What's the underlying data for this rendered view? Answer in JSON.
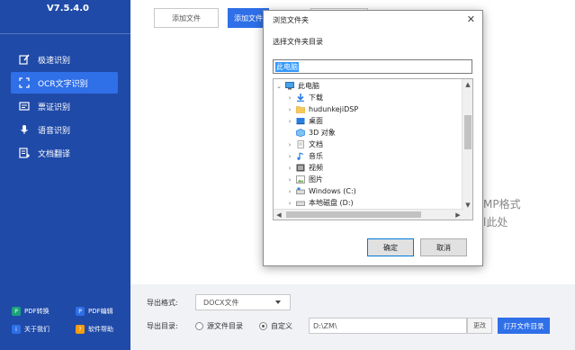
{
  "app": {
    "version": "V7.5.4.0"
  },
  "sidebar": {
    "items": [
      {
        "label": "极速识别",
        "icon": "edit-icon"
      },
      {
        "label": "OCR文字识别",
        "icon": "ocr-icon",
        "active": true
      },
      {
        "label": "票证识别",
        "icon": "ticket-icon"
      },
      {
        "label": "语音识别",
        "icon": "microphone-icon"
      },
      {
        "label": "文档翻译",
        "icon": "translate-icon"
      }
    ],
    "bottom_links": [
      {
        "label": "PDF转换",
        "color": "#1aa37a"
      },
      {
        "label": "PDF编辑",
        "color": "#2f6fe8"
      },
      {
        "label": "关于我们",
        "color": "#2f6fe8"
      },
      {
        "label": "软件帮助",
        "color": "#f39c12"
      }
    ]
  },
  "toolbar": {
    "add_file": "添加文件",
    "add_folder": "添加文件"
  },
  "dropzone": {
    "line1": "MP格式",
    "line2": "l此处"
  },
  "export": {
    "format_label": "导出格式:",
    "format_value": "DOCX文件",
    "dir_label": "导出目录:",
    "radio_source": "源文件目录",
    "radio_custom": "自定义",
    "path_value": "D:\\ZM\\",
    "change_btn": "更改",
    "open_btn": "打开文件目录"
  },
  "dialog": {
    "title": "浏览文件夹",
    "close": "✕",
    "subtitle": "选择文件夹目录",
    "folder_value": "此电脑",
    "tree": [
      {
        "label": "此电脑",
        "level": 0,
        "arrow": "⌄",
        "icon": "computer-icon"
      },
      {
        "label": "下载",
        "level": 1,
        "arrow": "›",
        "icon": "download-folder-icon"
      },
      {
        "label": "hudunkejiDSP",
        "level": 1,
        "arrow": "›",
        "icon": "folder-icon"
      },
      {
        "label": "桌面",
        "level": 1,
        "arrow": "›",
        "icon": "desktop-folder-icon"
      },
      {
        "label": "3D 对象",
        "level": 1,
        "arrow": "",
        "icon": "3d-objects-icon"
      },
      {
        "label": "文档",
        "level": 1,
        "arrow": "›",
        "icon": "documents-icon"
      },
      {
        "label": "音乐",
        "level": 1,
        "arrow": "›",
        "icon": "music-icon"
      },
      {
        "label": "视频",
        "level": 1,
        "arrow": "›",
        "icon": "video-icon"
      },
      {
        "label": "图片",
        "level": 1,
        "arrow": "›",
        "icon": "pictures-icon"
      },
      {
        "label": "Windows (C:)",
        "level": 1,
        "arrow": "›",
        "icon": "drive-icon"
      },
      {
        "label": "本地磁盘 (D:)",
        "level": 1,
        "arrow": "›",
        "icon": "drive-icon"
      }
    ],
    "ok": "确定",
    "cancel": "取消"
  },
  "colors": {
    "sidebar_bg": "#1f4aa8",
    "accent": "#2f6fe8"
  }
}
